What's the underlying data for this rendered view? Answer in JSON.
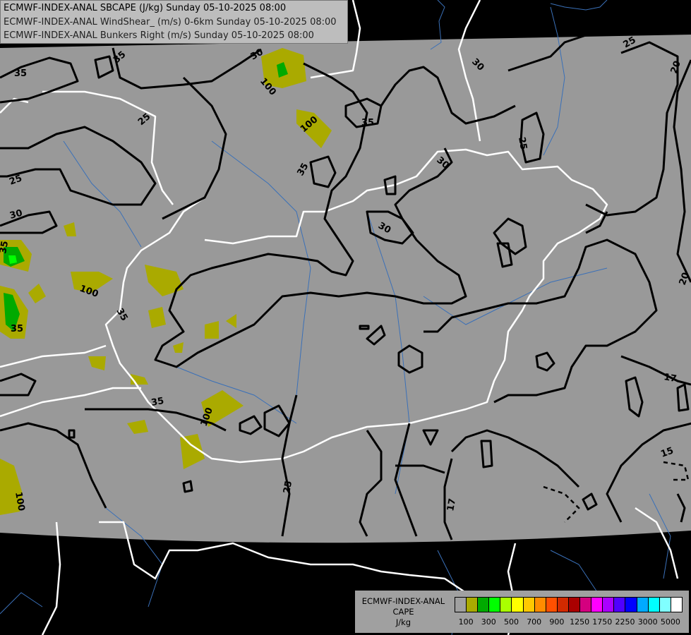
{
  "header": {
    "line1": "ECMWF-INDEX-ANAL SBCAPE (J/kg) Sunday 05-10-2025 08:00",
    "line2": "ECMWF-INDEX-ANAL WindShear_ (m/s) 0-6km Sunday 05-10-2025 08:00",
    "line3": "ECMWF-INDEX-ANAL Bunkers Right (m/s) Sunday 05-10-2025 08:00"
  },
  "legend": {
    "title_line1": "ECMWF-INDEX-ANAL",
    "title_line2": "CAPE",
    "title_line3": "J/kg",
    "colors": [
      "#a0a0a0",
      "#aaaa00",
      "#00aa00",
      "#00ff00",
      "#aaff00",
      "#ffff00",
      "#ffc800",
      "#ff8c00",
      "#ff5000",
      "#d22a00",
      "#aa0000",
      "#d4007f",
      "#ff00ff",
      "#aa00ff",
      "#5000ff",
      "#0000ff",
      "#00aaff",
      "#00ffff",
      "#80ffff",
      "#ffffff"
    ],
    "tick_labels": [
      "100",
      "300",
      "500",
      "700",
      "900",
      "1250",
      "1750",
      "2250",
      "3000",
      "5000"
    ]
  },
  "map": {
    "field_color": "#999999",
    "cape_color": "#aaaa00",
    "cape_high_color": "#00aa00",
    "contour_labels": [
      {
        "text": "35"
      },
      {
        "text": "35"
      },
      {
        "text": "25"
      },
      {
        "text": "30"
      },
      {
        "text": "100"
      },
      {
        "text": "100"
      },
      {
        "text": "35"
      },
      {
        "text": "30"
      },
      {
        "text": "25"
      },
      {
        "text": "20"
      },
      {
        "text": "25"
      },
      {
        "text": "30"
      },
      {
        "text": "30"
      },
      {
        "text": "35"
      },
      {
        "text": "25"
      },
      {
        "text": "30"
      },
      {
        "text": "35"
      },
      {
        "text": "35"
      },
      {
        "text": "100"
      },
      {
        "text": "35"
      },
      {
        "text": "100"
      },
      {
        "text": "100"
      },
      {
        "text": "25"
      },
      {
        "text": "17"
      },
      {
        "text": "17"
      },
      {
        "text": "15"
      },
      {
        "text": "20"
      },
      {
        "text": "35"
      }
    ]
  }
}
